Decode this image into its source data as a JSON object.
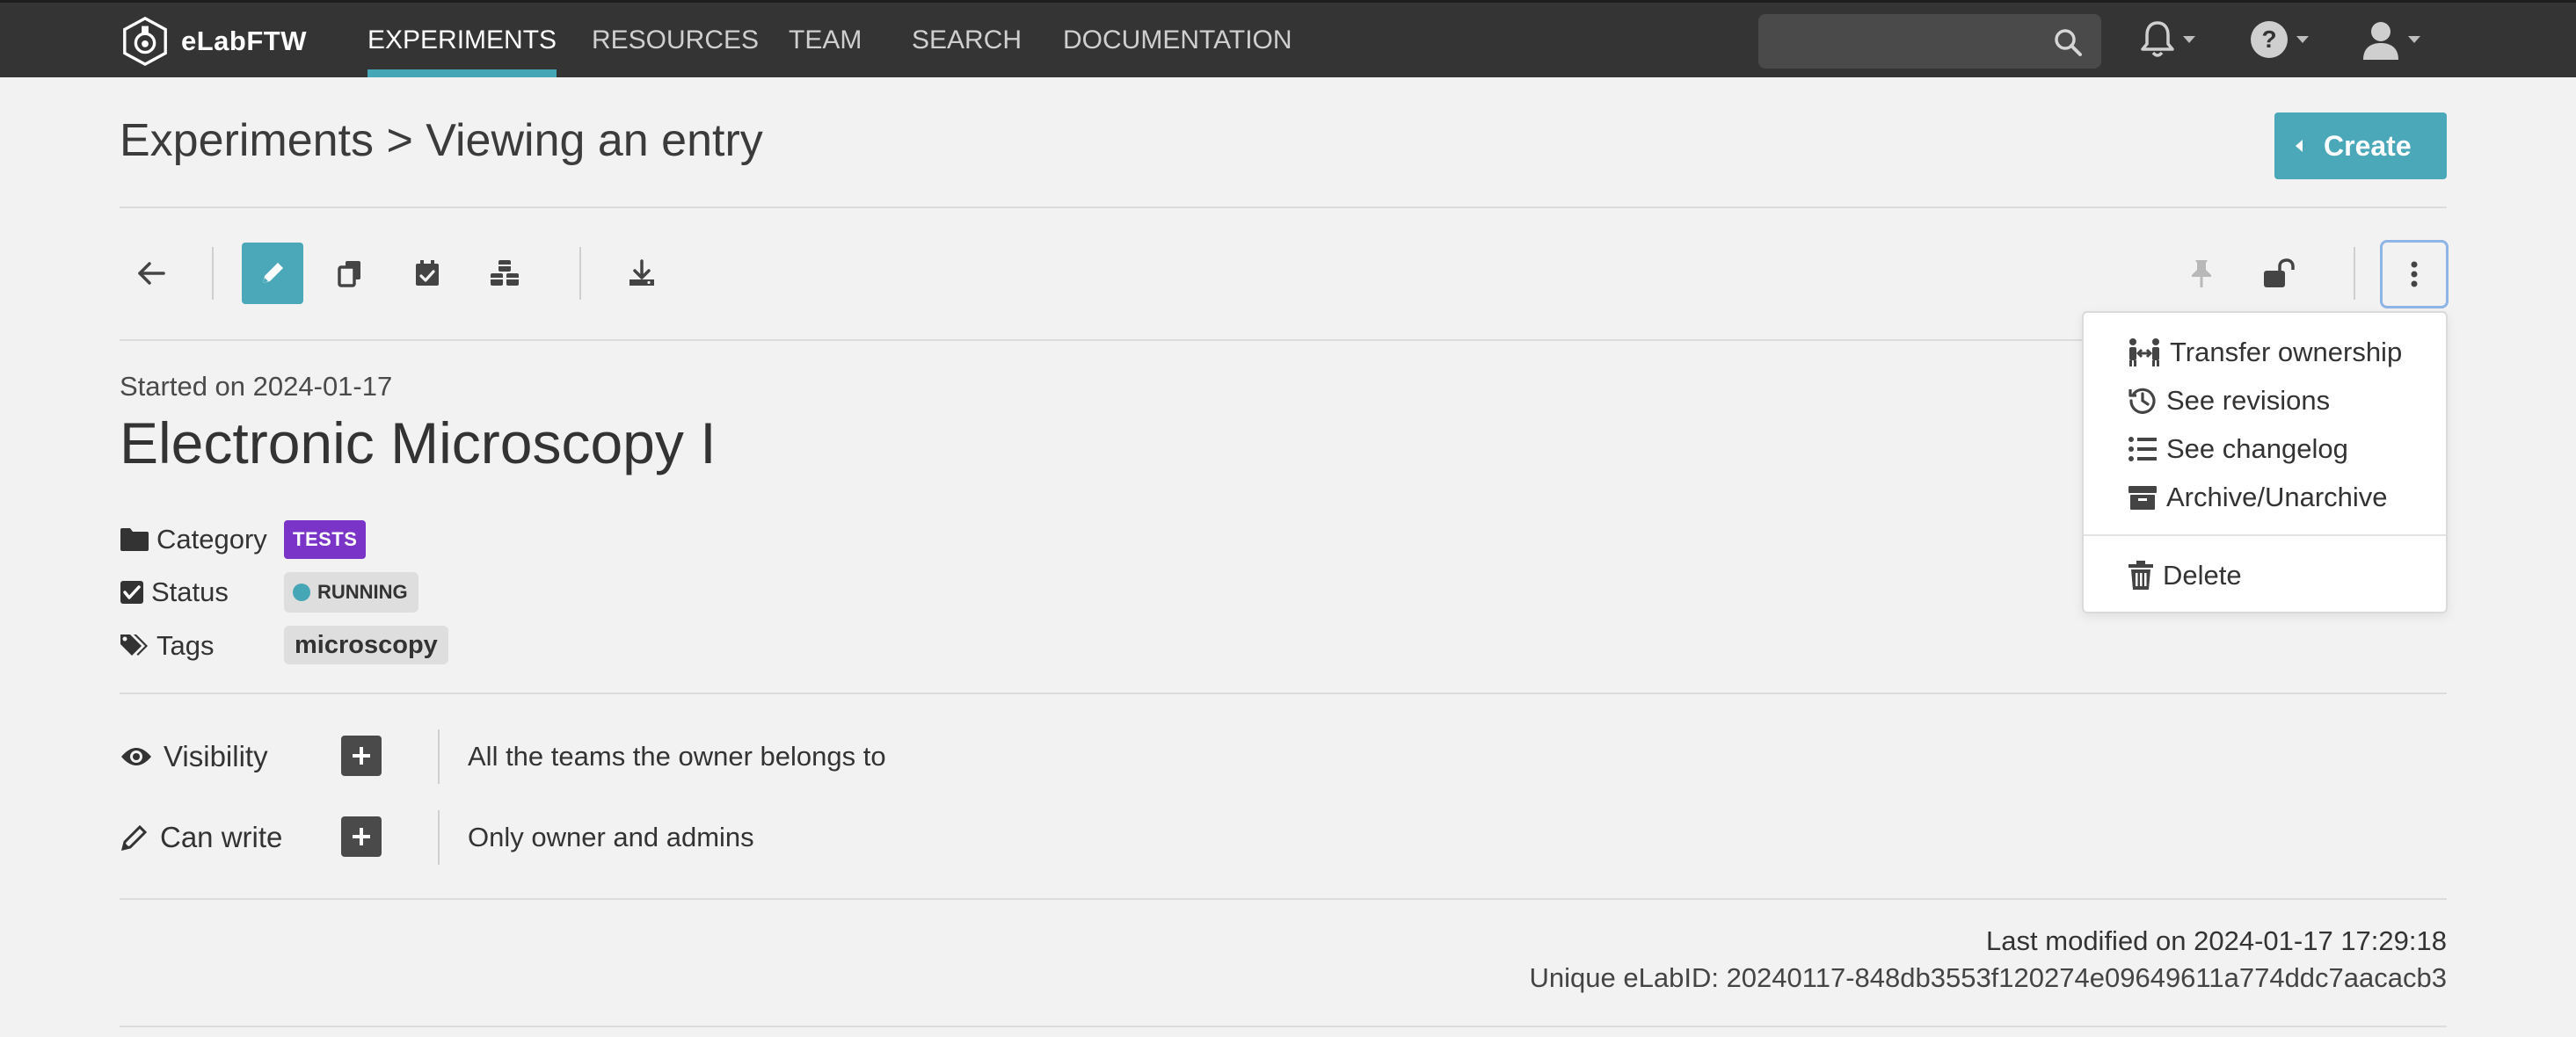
{
  "navbar": {
    "brand": "eLabFTW",
    "links": [
      "EXPERIMENTS",
      "RESOURCES",
      "TEAM",
      "SEARCH",
      "DOCUMENTATION"
    ],
    "active_link": "EXPERIMENTS",
    "search_placeholder": "",
    "icons": [
      "bell-icon",
      "help-icon",
      "user-icon"
    ]
  },
  "header": {
    "title": "Experiments > Viewing an entry",
    "create_label": "Create"
  },
  "toolbar": {
    "left_icons": [
      "arrow-left-icon",
      "pencil-icon",
      "duplicate-icon",
      "calendar-check-icon",
      "cubes-icon",
      "download-icon"
    ],
    "right_icons": [
      "pin-icon",
      "unlock-icon",
      "more-vertical-icon"
    ]
  },
  "more_menu": {
    "items": [
      {
        "label": "Transfer ownership",
        "icon": "transfer-ownership-icon"
      },
      {
        "label": "See revisions",
        "icon": "history-icon"
      },
      {
        "label": "See changelog",
        "icon": "list-icon"
      },
      {
        "label": "Archive/Unarchive",
        "icon": "archive-icon"
      }
    ],
    "delete_label": "Delete"
  },
  "entry": {
    "started": "Started on 2024-01-17",
    "title": "Electronic Microscopy I",
    "category_label": "Category",
    "category_value": "TESTS",
    "category_color": "#7a34c8",
    "status_label": "Status",
    "status_value": "RUNNING",
    "status_color": "#45a6b6",
    "tags_label": "Tags",
    "tag": "microscopy"
  },
  "permissions": {
    "visibility_label": "Visibility",
    "visibility_value": "All the teams the owner belongs to",
    "canwrite_label": "Can write",
    "canwrite_value": "Only owner and admins"
  },
  "footer": {
    "last_modified": "Last modified on 2024-01-17 17:29:18",
    "elabid": "Unique eLabID: 20240117-848db3553f120274e09649611a774ddc7aacacb3"
  },
  "colors": {
    "navbar_bg": "#343434",
    "accent": "#4aa8b8",
    "page_bg": "#f2f2f2"
  }
}
